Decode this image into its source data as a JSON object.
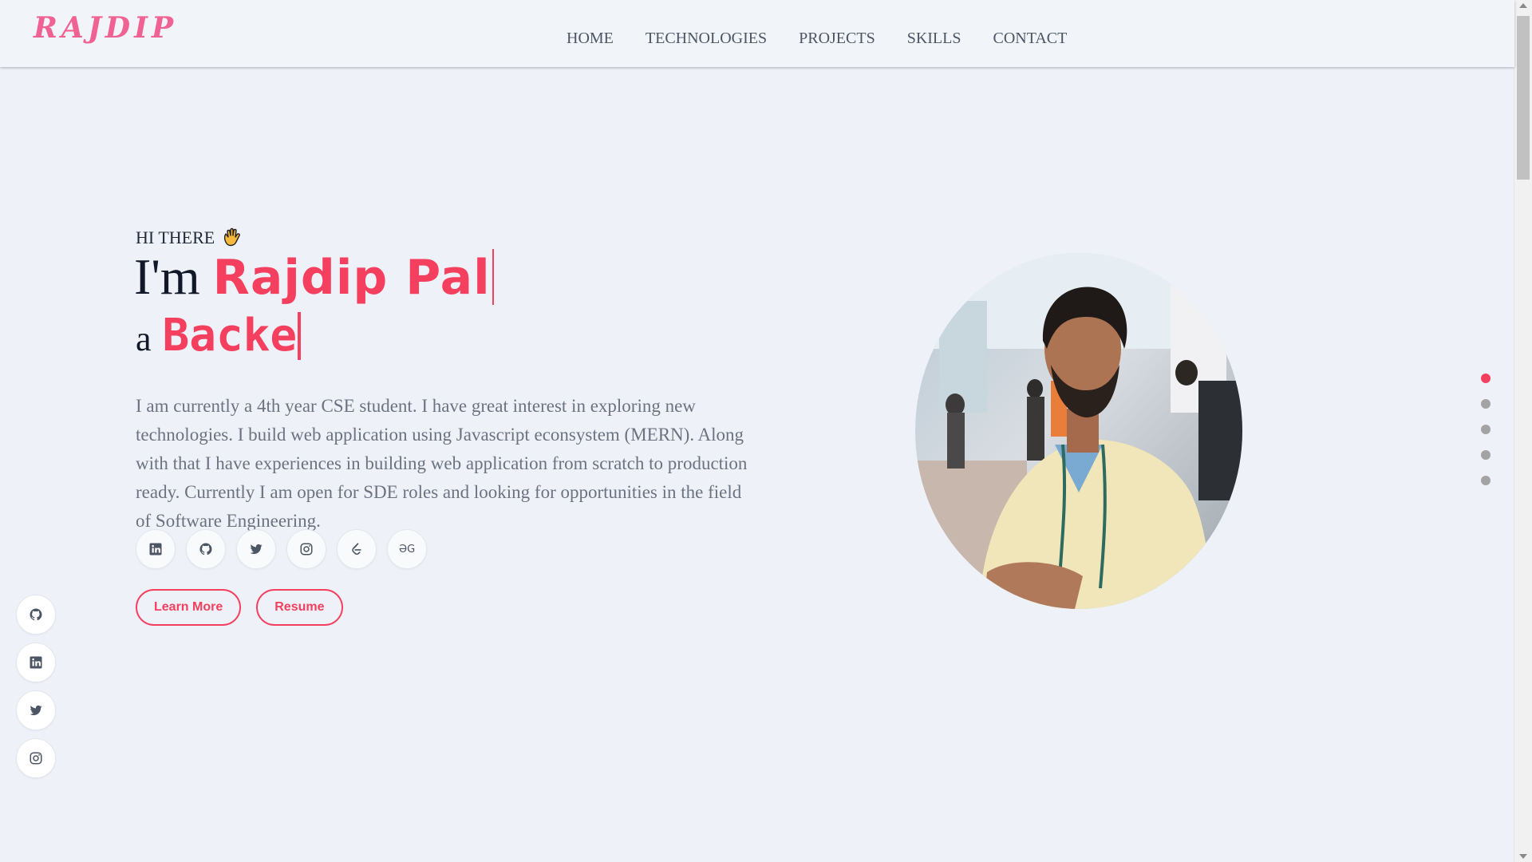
{
  "header": {
    "logo": "RAJDIP",
    "nav": [
      {
        "label": "HOME"
      },
      {
        "label": "TECHNOLOGIES"
      },
      {
        "label": "PROJECTS"
      },
      {
        "label": "SKILLS"
      },
      {
        "label": "CONTACT"
      }
    ]
  },
  "hero": {
    "greeting": "HI THERE",
    "greeting_icon": "waving-hand-icon",
    "name_prefix": "I'm",
    "name": "Rajdip Pal",
    "role_prefix": "a",
    "role_typed": "Backe",
    "bio": "I am currently a 4th year CSE student. I have great interest in exploring new technologies. I build web application using Javascript econsystem (MERN). Along with that I have experiences in building web application from scratch to production ready. Currently I am open for SDE roles and looking for opportunities in the field of Software Engineering.",
    "socials": [
      "linkedin-icon",
      "github-icon",
      "twitter-icon",
      "instagram-icon",
      "leetcode-icon",
      "geeksforgeeks-icon"
    ],
    "gfg_text": "ƏG",
    "buttons": {
      "learn_more": "Learn More",
      "resume": "Resume"
    }
  },
  "side_socials": [
    "github-icon",
    "linkedin-icon",
    "twitter-icon",
    "instagram-icon"
  ],
  "section_dots": {
    "count": 5,
    "active_index": 0
  },
  "colors": {
    "accent": "#f43f5e",
    "logo": "#f06292",
    "background": "#eef2f8",
    "text_muted": "#6b7280"
  }
}
